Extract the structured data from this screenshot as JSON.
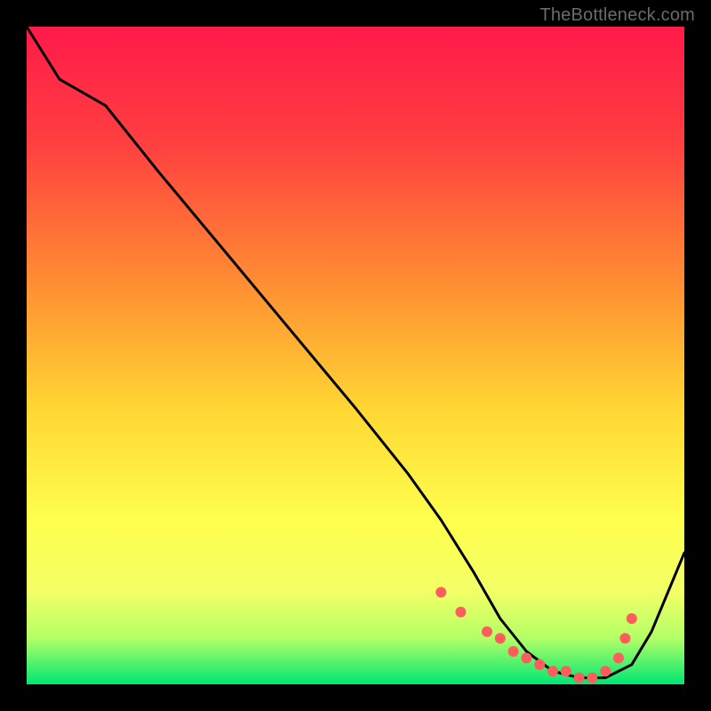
{
  "watermark": "TheBottleneck.com",
  "colors": {
    "bg_black": "#000000",
    "grad_top": "#ff1a49",
    "grad_mid1": "#ff7a33",
    "grad_mid2": "#ffd633",
    "grad_mid3": "#ffff66",
    "grad_low": "#d9ff66",
    "grad_bottom": "#00e673",
    "curve": "#000000",
    "dot_fill": "#ff5c5c",
    "dot_stroke": "#ff5c5c"
  },
  "chart_data": {
    "type": "line",
    "title": "",
    "xlabel": "",
    "ylabel": "",
    "xlim": [
      0,
      100
    ],
    "ylim": [
      0,
      100
    ],
    "series": [
      {
        "name": "bottleneck-curve",
        "x": [
          0,
          5,
          12,
          20,
          30,
          40,
          50,
          58,
          63,
          68,
          72,
          76,
          80,
          84,
          88,
          92,
          95,
          100
        ],
        "y": [
          100,
          92,
          88,
          78,
          66,
          54,
          42,
          32,
          25,
          17,
          10,
          5,
          2,
          1,
          1,
          3,
          8,
          20
        ]
      }
    ],
    "highlight_points": {
      "name": "optimal-range-dots",
      "x": [
        63,
        66,
        70,
        72,
        74,
        76,
        78,
        80,
        82,
        84,
        86,
        88,
        90,
        91,
        92
      ],
      "y": [
        14,
        11,
        8,
        7,
        5,
        4,
        3,
        2,
        2,
        1,
        1,
        2,
        4,
        7,
        10
      ]
    }
  }
}
